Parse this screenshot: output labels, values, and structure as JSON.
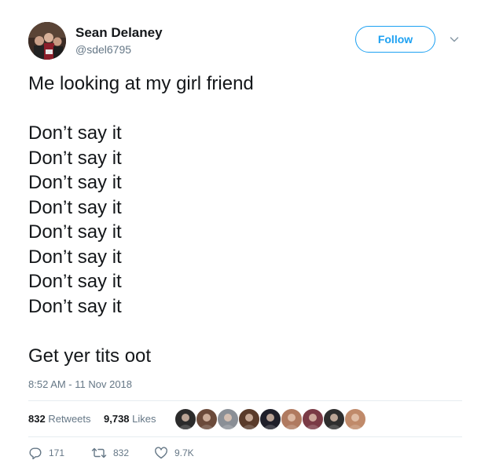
{
  "author": {
    "name": "Sean Delaney",
    "handle": "@sdel6795"
  },
  "follow_button": {
    "label": "Follow"
  },
  "tweet": {
    "intro": "Me looking at my girl friend",
    "repeated_lines": [
      "Don’t say it",
      "Don’t say it",
      "Don’t say it",
      "Don’t say it",
      "Don’t say it",
      "Don’t say it",
      "Don’t say it",
      "Don’t say it"
    ],
    "closing": "Get yer tits oot"
  },
  "timestamp": "8:52 AM - 11 Nov 2018",
  "stats": {
    "retweets_count": "832",
    "retweets_label": "Retweets",
    "likes_count": "9,738",
    "likes_label": "Likes"
  },
  "liker_avatars": [
    {
      "color": "#2b2b2b"
    },
    {
      "color": "#6b4a3a"
    },
    {
      "color": "#8a8f96"
    },
    {
      "color": "#5a3b2a"
    },
    {
      "color": "#1f1f2a"
    },
    {
      "color": "#b07a60"
    },
    {
      "color": "#7a3a45"
    },
    {
      "color": "#2e2e2e"
    },
    {
      "color": "#c08a6a"
    }
  ],
  "actions": {
    "replies": "171",
    "retweets": "832",
    "likes": "9.7K"
  },
  "colors": {
    "accent": "#1da1f2",
    "text": "#14171a",
    "muted": "#657786",
    "divider": "#e6ecf0"
  },
  "icons": {
    "reply": "reply-icon",
    "retweet": "retweet-icon",
    "like": "heart-icon",
    "caret": "chevron-down-icon"
  }
}
